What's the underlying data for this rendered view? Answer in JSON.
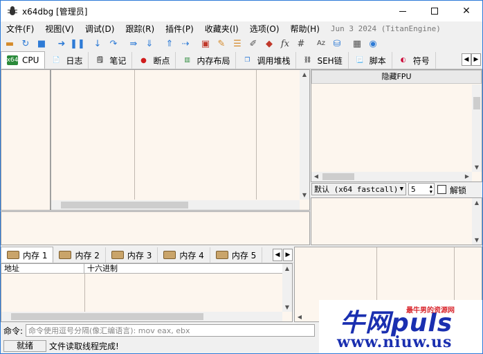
{
  "window": {
    "title": "x64dbg [管理员]",
    "minimize": "–",
    "maximize": "☐",
    "close": "✕"
  },
  "menu": {
    "items": [
      "文件(F)",
      "视图(V)",
      "调试(D)",
      "跟踪(R)",
      "插件(P)",
      "收藏夹(I)",
      "选项(O)",
      "帮助(H)"
    ],
    "build_info": "Jun 3 2024 (TitanEngine)"
  },
  "toolbar": {
    "icons": [
      "open-folder-icon",
      "restart-icon",
      "stop-icon",
      "run-icon",
      "pause-icon",
      "step-into-icon",
      "step-over-icon",
      "run-to-user-icon",
      "run-to-return-icon",
      "step-up-icon",
      "trace-icon",
      "breakpoint-icon",
      "patch-icon",
      "script-icon",
      "comment-icon",
      "label-icon",
      "function-icon",
      "hash-icon",
      "font-icon",
      "module-icon",
      "calculator-icon",
      "globe-icon"
    ],
    "fx_label": "fx",
    "hash_label": "#",
    "az_label": "Aᴢ"
  },
  "tabs": [
    {
      "label": "CPU",
      "icon": "cpu-icon",
      "icon_text": "x64"
    },
    {
      "label": "日志",
      "icon": "log-icon"
    },
    {
      "label": "笔记",
      "icon": "notes-icon"
    },
    {
      "label": "断点",
      "icon": "breakpoint-dot-icon"
    },
    {
      "label": "内存布局",
      "icon": "memory-map-icon"
    },
    {
      "label": "调用堆栈",
      "icon": "call-stack-icon"
    },
    {
      "label": "SEH链",
      "icon": "seh-icon"
    },
    {
      "label": "脚本",
      "icon": "script-icon"
    },
    {
      "label": "符号",
      "icon": "symbols-icon"
    }
  ],
  "registers": {
    "hide_fpu_label": "隐藏FPU",
    "calling_convention": "默认 (x64 fastcall)",
    "arg_count": "5",
    "lock_label": "解锁"
  },
  "memory_tabs": [
    "内存 1",
    "内存 2",
    "内存 3",
    "内存 4",
    "内存 5"
  ],
  "dump_headers": {
    "address": "地址",
    "hex": "十六进制"
  },
  "command": {
    "label": "命令:",
    "placeholder": "命令使用逗号分隔(像汇编语言): mov eax, ebx"
  },
  "status": {
    "state": "就绪",
    "message": "文件读取线程完成!"
  },
  "watermark": {
    "big": "牛网puls",
    "small": "最牛男的资源网",
    "url": "www.niuw.us"
  }
}
